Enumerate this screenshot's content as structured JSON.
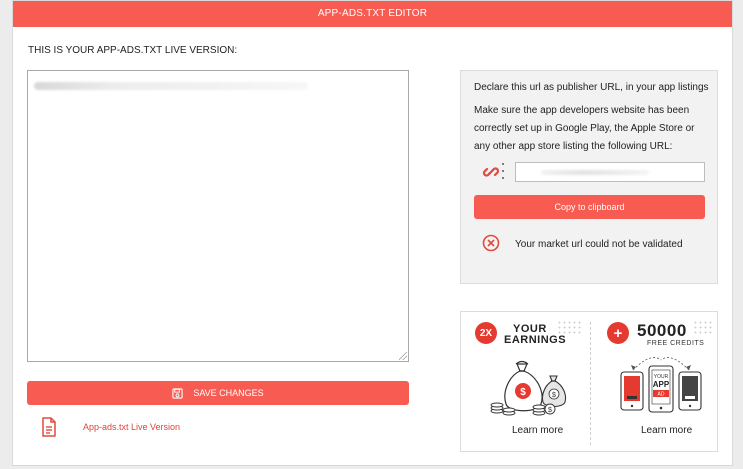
{
  "header": {
    "title": "APP-ADS.TXT EDITOR"
  },
  "editor": {
    "title": "THIS IS YOUR APP-ADS.TXT LIVE VERSION:",
    "save_label": "SAVE CHANGES",
    "live_link": "App-ads.txt Live Version"
  },
  "info": {
    "title": "Declare this url as publisher URL, in your app listings",
    "description": "Make sure the app developers website has been correctly set up in Google Play, the Apple Store or any other app store listing the following URL:",
    "copy_label": "Copy to clipboard",
    "error_text": "Your market url could not be validated"
  },
  "promo": {
    "left": {
      "badge": "2X",
      "line1": "YOUR",
      "line2": "EARNINGS",
      "learn": "Learn more"
    },
    "right": {
      "badge": "+",
      "number": "50000",
      "subtitle": "FREE CREDITS",
      "phone_line1": "YOUR",
      "phone_line2": "APP",
      "phone_line3": "AD",
      "learn": "Learn more"
    }
  },
  "icons": {
    "save": "floppy-disk-icon",
    "doc": "document-icon",
    "link": "chain-link-icon",
    "error": "error-circle-x-icon"
  },
  "colors": {
    "accent": "#f85b52",
    "error": "#e04a3f",
    "background": "#ececec"
  }
}
